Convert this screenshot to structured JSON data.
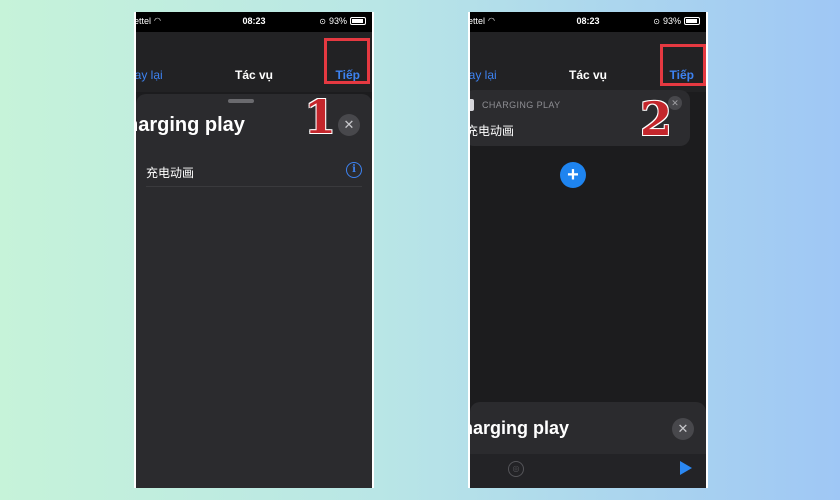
{
  "colors": {
    "accent": "#3d82f0",
    "highlight": "#e53941",
    "step_number": "#c4262c",
    "background": "#1c1c1e"
  },
  "status_bar": {
    "carrier": "ettel",
    "time": "08:23",
    "battery": "93%"
  },
  "screen1": {
    "nav": {
      "back": "uay lại",
      "title": "Tác vụ",
      "next": "Tiếp"
    },
    "step_number": "1",
    "sheet": {
      "title": "harging play",
      "close_icon": "close-icon"
    },
    "list_item": {
      "label": "充电动画",
      "info_icon": "info-icon"
    }
  },
  "screen2": {
    "nav": {
      "back": "uay lại",
      "title": "Tác vụ",
      "next": "Tiếp"
    },
    "step_number": "2",
    "card": {
      "app_name": "CHARGING PLAY",
      "value": "充电动画",
      "close_icon": "close-icon"
    },
    "add_icon": "plus-icon",
    "bottom_panel": {
      "title": "harging play",
      "close_icon": "close-icon",
      "play_icon": "play-icon"
    }
  }
}
